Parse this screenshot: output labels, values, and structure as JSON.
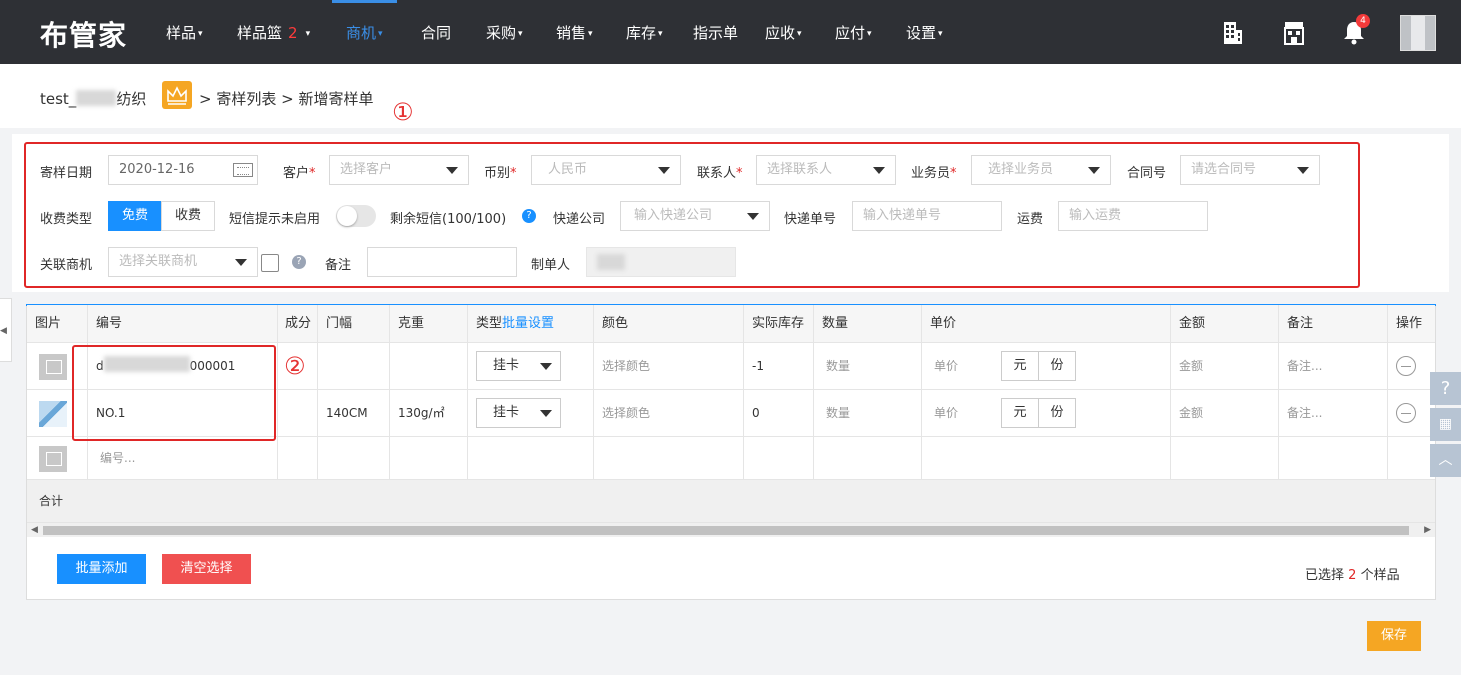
{
  "nav": {
    "logo": "布管家",
    "items": [
      {
        "label": "样品",
        "caret": "▾"
      },
      {
        "label": "样品篮",
        "badge": "2",
        "caret": "▾"
      },
      {
        "label": "商机",
        "caret": "▾"
      },
      {
        "label": "合同"
      },
      {
        "label": "采购",
        "caret": "▾"
      },
      {
        "label": "销售",
        "caret": "▾"
      },
      {
        "label": "库存",
        "caret": "▾"
      },
      {
        "label": "指示单"
      },
      {
        "label": "应收",
        "caret": "▾"
      },
      {
        "label": "应付",
        "caret": "▾"
      },
      {
        "label": "设置",
        "caret": "▾"
      }
    ],
    "bell_count": "4",
    "icons": [
      "building-icon",
      "store-icon",
      "bell-icon"
    ]
  },
  "breadcrumb": {
    "company_prefix": "test_",
    "company_suffix": "纺织",
    "path": "> 寄样列表 > 新增寄样单"
  },
  "annotations": {
    "one": "①",
    "two": "②"
  },
  "form": {
    "date_label": "寄样日期",
    "date_value": "2020-12-16",
    "customer_label": "客户",
    "customer_placeholder": "选择客户",
    "currency_label": "币别",
    "currency_placeholder": "人民币",
    "contact_label": "联系人",
    "contact_placeholder": "选择联系人",
    "salesman_label": "业务员",
    "salesman_placeholder": "选择业务员",
    "contract_label": "合同号",
    "contract_placeholder": "请选合同号",
    "fee_type_label": "收费类型",
    "fee_free": "免费",
    "fee_paid": "收费",
    "sms_label": "短信提示未启用",
    "sms_remaining": "剩余短信(100/100)",
    "express_label": "快递公司",
    "express_placeholder": "输入快递公司",
    "tracking_label": "快递单号",
    "tracking_placeholder": "输入快递单号",
    "freight_label": "运费",
    "freight_placeholder": "输入运费",
    "opportunity_label": "关联商机",
    "opportunity_placeholder": "选择关联商机",
    "remark_label": "备注",
    "remark_value": "",
    "creator_label": "制单人"
  },
  "table": {
    "headers": {
      "image": "图片",
      "code": "编号",
      "composition": "成分",
      "width": "门幅",
      "weight": "克重",
      "type": "类型",
      "batch_setting": "批量设置",
      "color": "颜色",
      "stock": "实际库存",
      "quantity": "数量",
      "price": "单价",
      "amount": "金额",
      "remark": "备注",
      "action": "操作"
    },
    "rows": [
      {
        "code_prefix": "d",
        "code_suffix": "000001",
        "composition": "",
        "width": "",
        "weight": "",
        "type": "挂卡",
        "color": "选择颜色",
        "stock": "-1",
        "quantity": "数量",
        "price": "单价",
        "unit_yuan": "元",
        "unit_fen": "份",
        "amount": "金额",
        "remark": "备注..."
      },
      {
        "code": "NO.1",
        "composition": "",
        "width": "140CM",
        "weight": "130g/㎡",
        "type": "挂卡",
        "color": "选择颜色",
        "stock": "0",
        "quantity": "数量",
        "price": "单价",
        "unit_yuan": "元",
        "unit_fen": "份",
        "amount": "金额",
        "remark": "备注..."
      }
    ],
    "new_row_placeholder": "编号...",
    "sum_label": "合计"
  },
  "footer": {
    "batch_add": "批量添加",
    "clear_selection": "清空选择",
    "selected_prefix": "已选择",
    "selected_count": "2",
    "selected_suffix": "个样品",
    "save": "保存"
  },
  "colors": {
    "nav_bg": "#2e3035",
    "accent_blue": "#1890ff",
    "danger_red": "#e02727",
    "save_orange": "#f5a623"
  }
}
